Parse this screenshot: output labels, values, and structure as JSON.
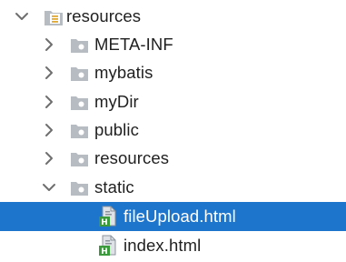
{
  "colors": {
    "selection": "#1e75cc",
    "chevron": "#6e6e6e",
    "folder": "#b7bcc2",
    "resources_stripe": "#e0a830",
    "html_file_badge": "#3a9a3c"
  },
  "tree": {
    "root": {
      "label": "resources",
      "expanded": true,
      "icon": "resources-folder-icon"
    },
    "children": [
      {
        "label": "META-INF",
        "expanded": false,
        "icon": "folder-icon"
      },
      {
        "label": "mybatis",
        "expanded": false,
        "icon": "folder-icon"
      },
      {
        "label": "myDir",
        "expanded": false,
        "icon": "folder-icon"
      },
      {
        "label": "public",
        "expanded": false,
        "icon": "folder-icon"
      },
      {
        "label": "resources",
        "expanded": false,
        "icon": "folder-icon"
      },
      {
        "label": "static",
        "expanded": true,
        "icon": "folder-icon"
      }
    ],
    "static_children": [
      {
        "label": "fileUpload.html",
        "selected": true,
        "icon": "html-file-icon",
        "badge": "H"
      },
      {
        "label": "index.html",
        "selected": false,
        "icon": "html-file-icon",
        "badge": "H"
      }
    ]
  }
}
